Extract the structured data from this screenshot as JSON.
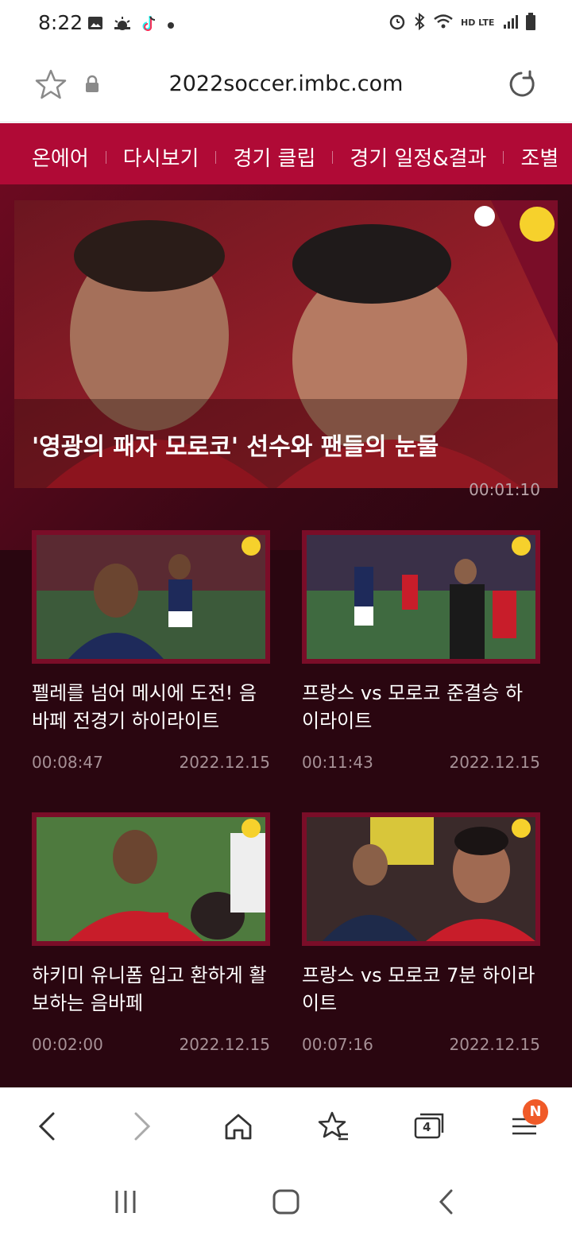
{
  "status": {
    "time": "8:22",
    "left_icons": [
      "gallery-icon",
      "weather-icon",
      "tiktok-icon",
      "dot-icon"
    ],
    "right_icons": [
      "alarm-icon",
      "bluetooth-icon",
      "wifi-icon",
      "hd-lte-icon",
      "signal-icon",
      "battery-icon"
    ],
    "network_label": "HD LTE"
  },
  "browser": {
    "url": "2022soccer.imbc.com"
  },
  "nav": {
    "items": [
      "온에어",
      "다시보기",
      "경기 클립",
      "경기 일정&결과",
      "조별"
    ]
  },
  "hero": {
    "title": "'영광의 패자 모로코' 선수와 팬들의 눈물",
    "duration": "00:01:10"
  },
  "cards": [
    {
      "title": "펠레를 넘어 메시에 도전! 음바페 전경기 하이라이트",
      "duration": "00:08:47",
      "date": "2022.12.15"
    },
    {
      "title": "프랑스 vs 모로코 준결승 하이라이트",
      "duration": "00:11:43",
      "date": "2022.12.15"
    },
    {
      "title": "하키미 유니폼 입고 환하게 활보하는 음바페",
      "duration": "00:02:00",
      "date": "2022.12.15"
    },
    {
      "title": "프랑스 vs 모로코 7분 하이라이트",
      "duration": "00:07:16",
      "date": "2022.12.15"
    }
  ],
  "toolbar": {
    "tabs_count": "4",
    "menu_badge": "N"
  },
  "colors": {
    "nav_bg": "#b00a36",
    "content_bg": "#2a0610",
    "badge": "#f05a28"
  }
}
